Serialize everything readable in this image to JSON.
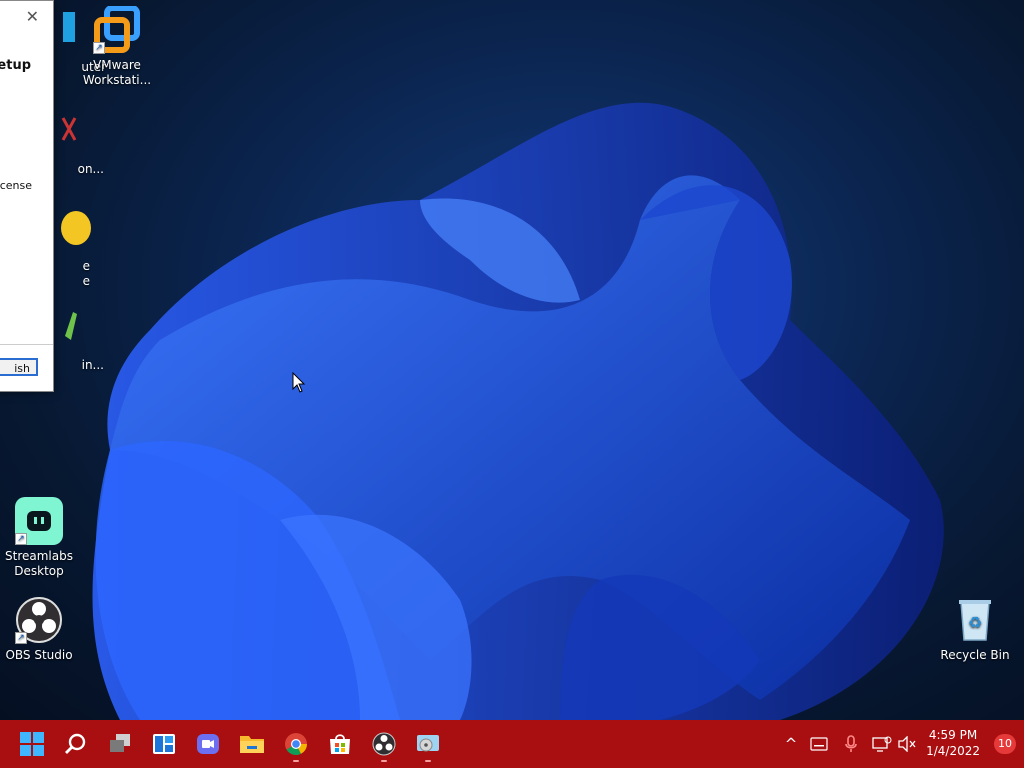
{
  "desktop": {
    "icons": [
      {
        "label": "uter",
        "icon": "computer-icon"
      },
      {
        "label": "VMware Workstati...",
        "icon": "vmware-workstation-icon"
      },
      {
        "label": "on...",
        "icon": "app-icon"
      },
      {
        "label": "e",
        "label2": "e",
        "icon": "app-icon"
      },
      {
        "label": "in...",
        "icon": "app-icon"
      },
      {
        "label": "Streamlabs Desktop",
        "icon": "streamlabs-icon"
      },
      {
        "label": "OBS Studio",
        "icon": "obs-studio-icon"
      },
      {
        "label": "Recycle Bin",
        "icon": "recycle-bin-icon"
      }
    ]
  },
  "dialog": {
    "title_fragment": "etup",
    "license_fragment": "icense",
    "button_fragment": "ish",
    "close_glyph": "✕"
  },
  "taskbar": {
    "accent": "#a90e10",
    "buttons": [
      "start",
      "search",
      "task-view",
      "widgets",
      "chat",
      "file-explorer",
      "chrome",
      "store",
      "obs-studio",
      "setup-app"
    ],
    "clock": {
      "time": "4:59 PM",
      "date": "1/4/2022"
    },
    "notifications": "10"
  }
}
